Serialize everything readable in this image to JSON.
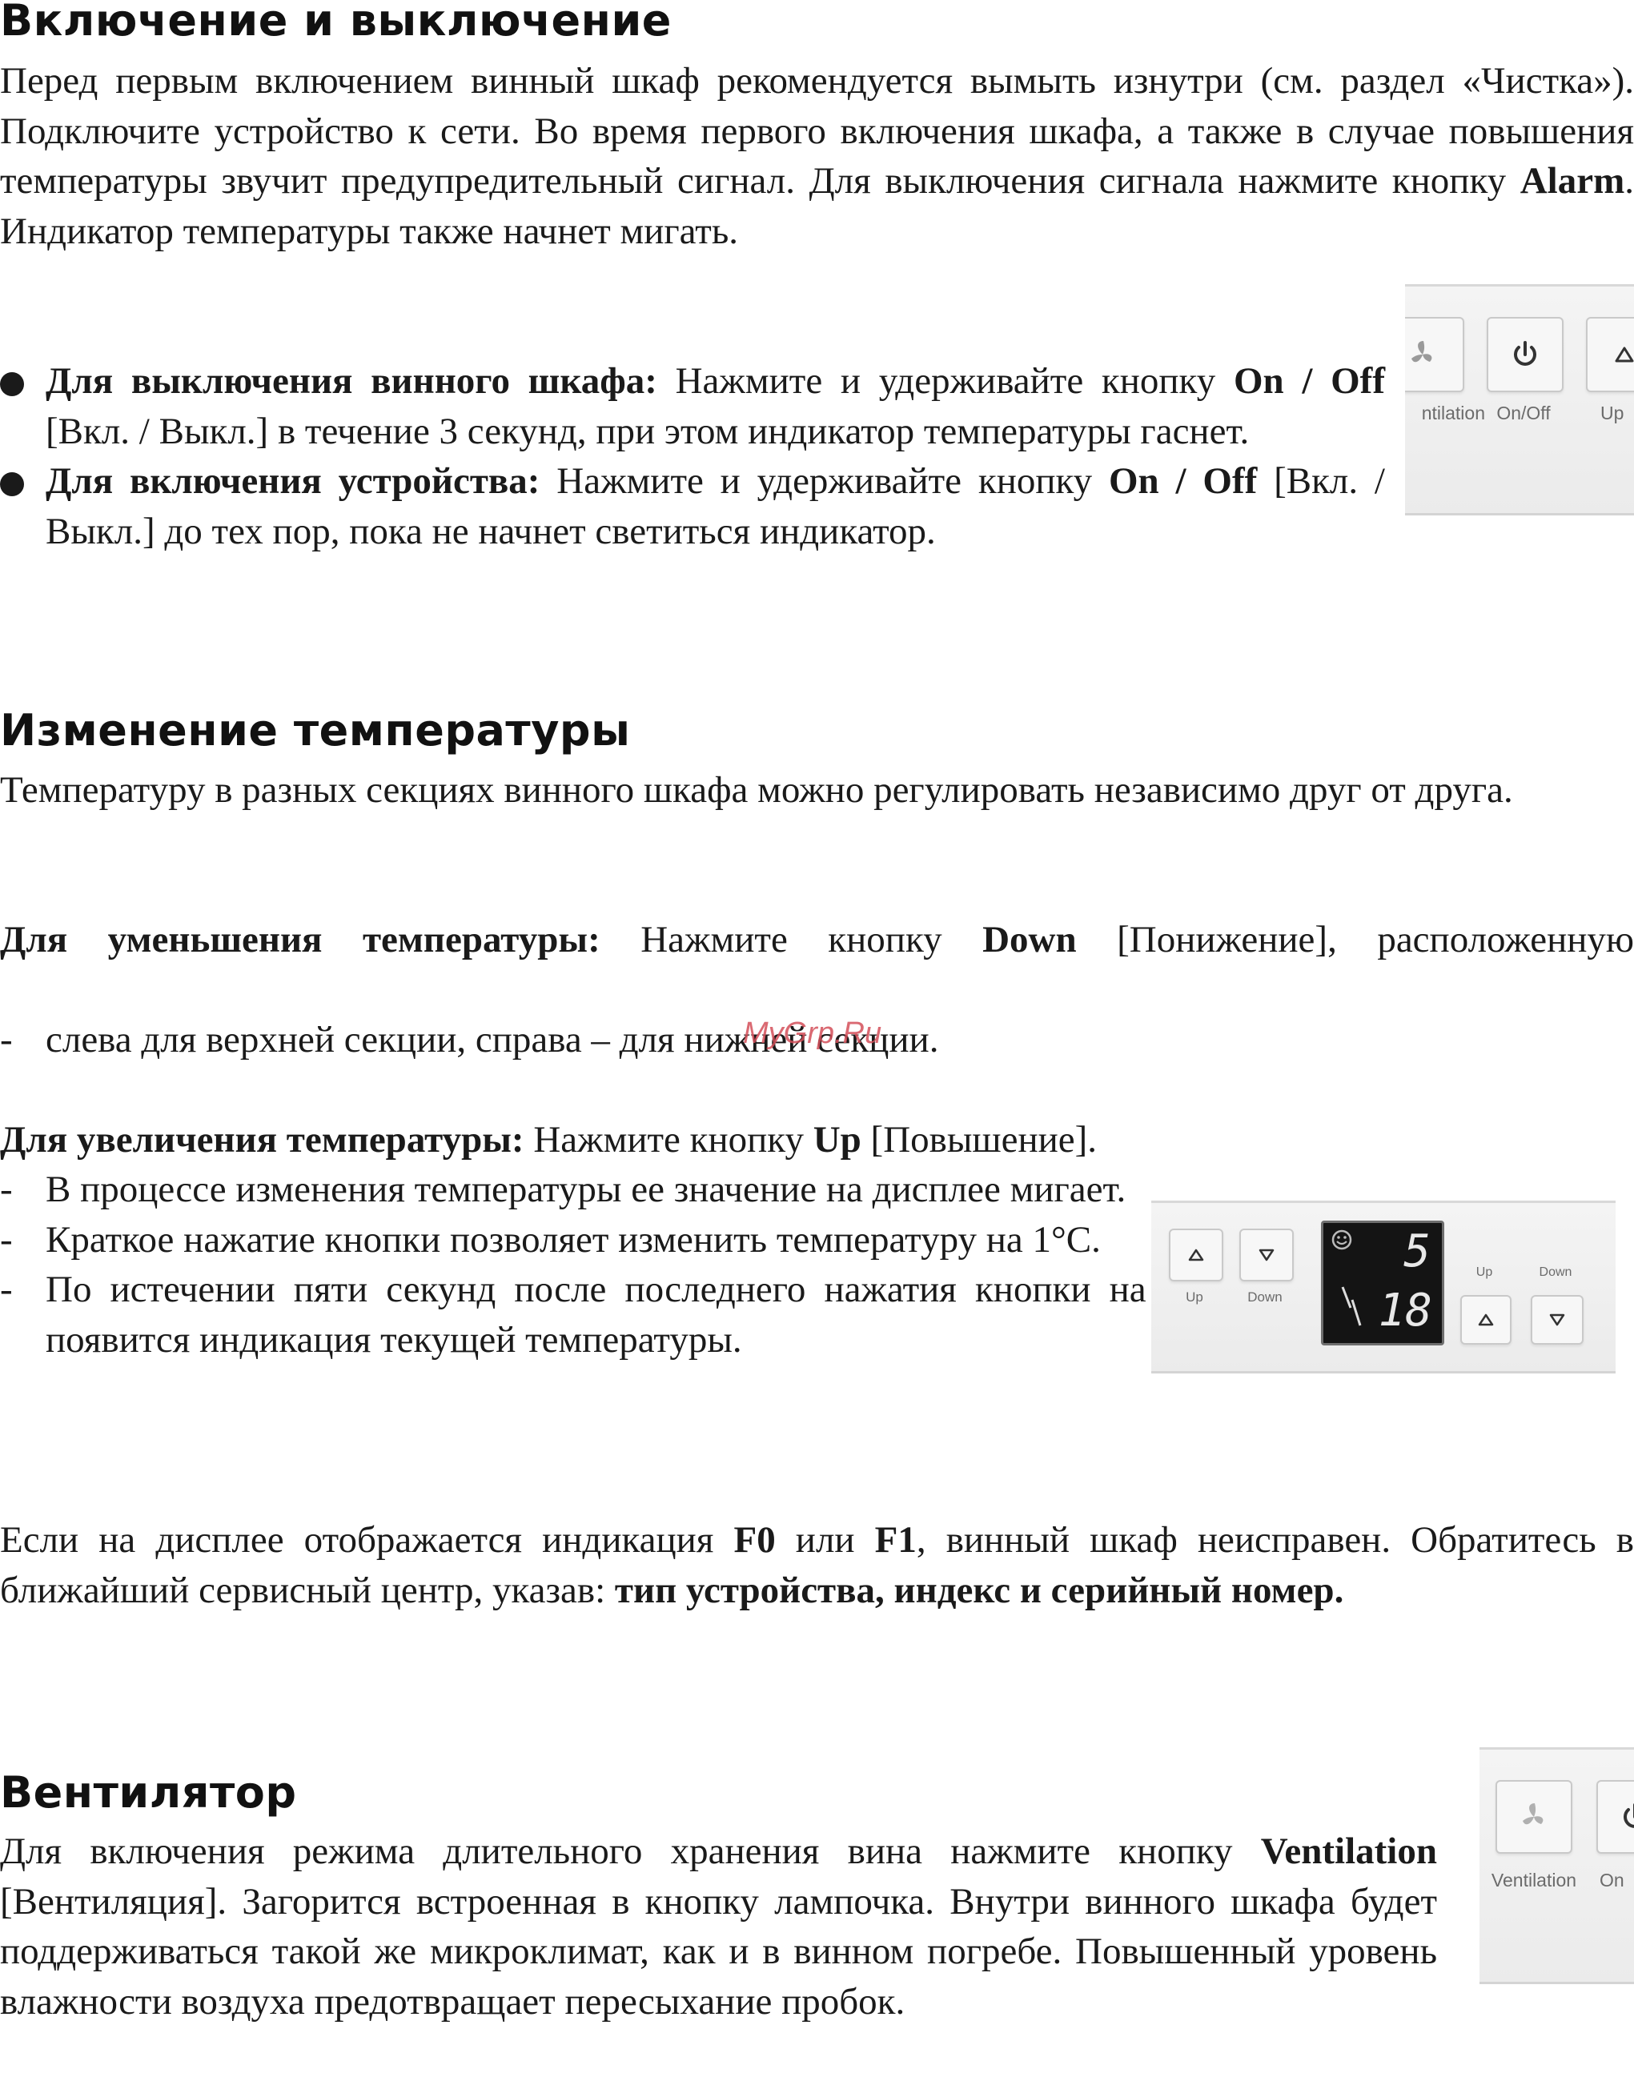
{
  "section1": {
    "heading": "Включение и выключение",
    "intro": {
      "t1": "Перед первым включением винный шкаф рекомендуется вымыть изнутри (см. раздел «Чистка»). Подключите устройство к сети. Во время первого включения шкафа, а также в случае повышения температуры звучит предупредительный сигнал. Для выключения сигнала нажмите кнопку ",
      "b1": "Alarm",
      "t2": ". Индикатор температуры также начнет мигать."
    },
    "bullets": [
      {
        "b1": "Для выключения винного шкафа:",
        "t1": " Нажмите и удерживайте кнопку ",
        "b2": "On / Off",
        "t2": " [Вкл. / Выкл.] в течение 3 секунд, при этом индикатор температуры гаснет."
      },
      {
        "b1": "Для включения устройства:",
        "t1": " Нажмите и удерживайте кнопку ",
        "b2": "On / Off",
        "t2": " [Вкл. / Выкл.] до тех пор, пока не начнет светиться индикатор."
      }
    ],
    "panel": {
      "labels": [
        "ntilation",
        "On/Off",
        "Up"
      ],
      "icons": [
        "fan-icon",
        "power-icon",
        "up-arrow-icon"
      ]
    }
  },
  "section2": {
    "heading": "Изменение температуры",
    "intro": "Температуру в разных секциях винного шкафа можно регулировать независимо друг от друга.",
    "decrease": {
      "b1": "Для уменьшения температуры:",
      "t1": " Нажмите кнопку ",
      "b2": "Down",
      "t2": " [Понижение], расположенную",
      "dash_item": "слева для верхней секции, справа – для нижней секции."
    },
    "increase": {
      "b1": "Для увеличения температуры:",
      "t1": " Нажмите кнопку ",
      "b2": "Up",
      "t2": " [Повышение].",
      "dash_items": [
        "В процессе изменения температуры ее значение на дисплее мигает.",
        "Краткое нажатие кнопки позволяет изменить температуру на 1°С.",
        "По истечении пяти секунд после последнего нажатия кнопки на дисплее появится индикация текущей температуры."
      ]
    },
    "error": {
      "t1": "Если на дисплее отображается индикация ",
      "b1": "F0",
      "t2": " или ",
      "b2": "F1",
      "t3": ", винный шкаф неисправен. Обратитесь в ближайший сервисный центр, указав: ",
      "b3": "тип устройства, индекс и серийный номер."
    },
    "panel": {
      "left_labels": [
        "Up",
        "Down"
      ],
      "right_labels": [
        "Up",
        "Down"
      ],
      "display_top": "5",
      "display_bottom": "18",
      "icons": [
        "smiley-icon",
        "up-arrow-icon",
        "down-arrow-icon"
      ]
    }
  },
  "section3": {
    "heading": "Вентилятор",
    "t1": "Для включения режима длительного хранения вина нажмите кнопку ",
    "b1": "Ventilation",
    "t2": " [Вентиляция]. Загорится встроенная в кнопку лампочка. Внутри винного шкафа будет поддерживаться такой же микроклимат, как и в винном погребе. Повышенный уровень влажности воздуха предотвращает пересыхание пробок.",
    "panel": {
      "labels": [
        "Ventilation",
        "On"
      ],
      "icons": [
        "fan-icon",
        "power-icon"
      ]
    }
  },
  "watermark": "MyGrp.Ru"
}
